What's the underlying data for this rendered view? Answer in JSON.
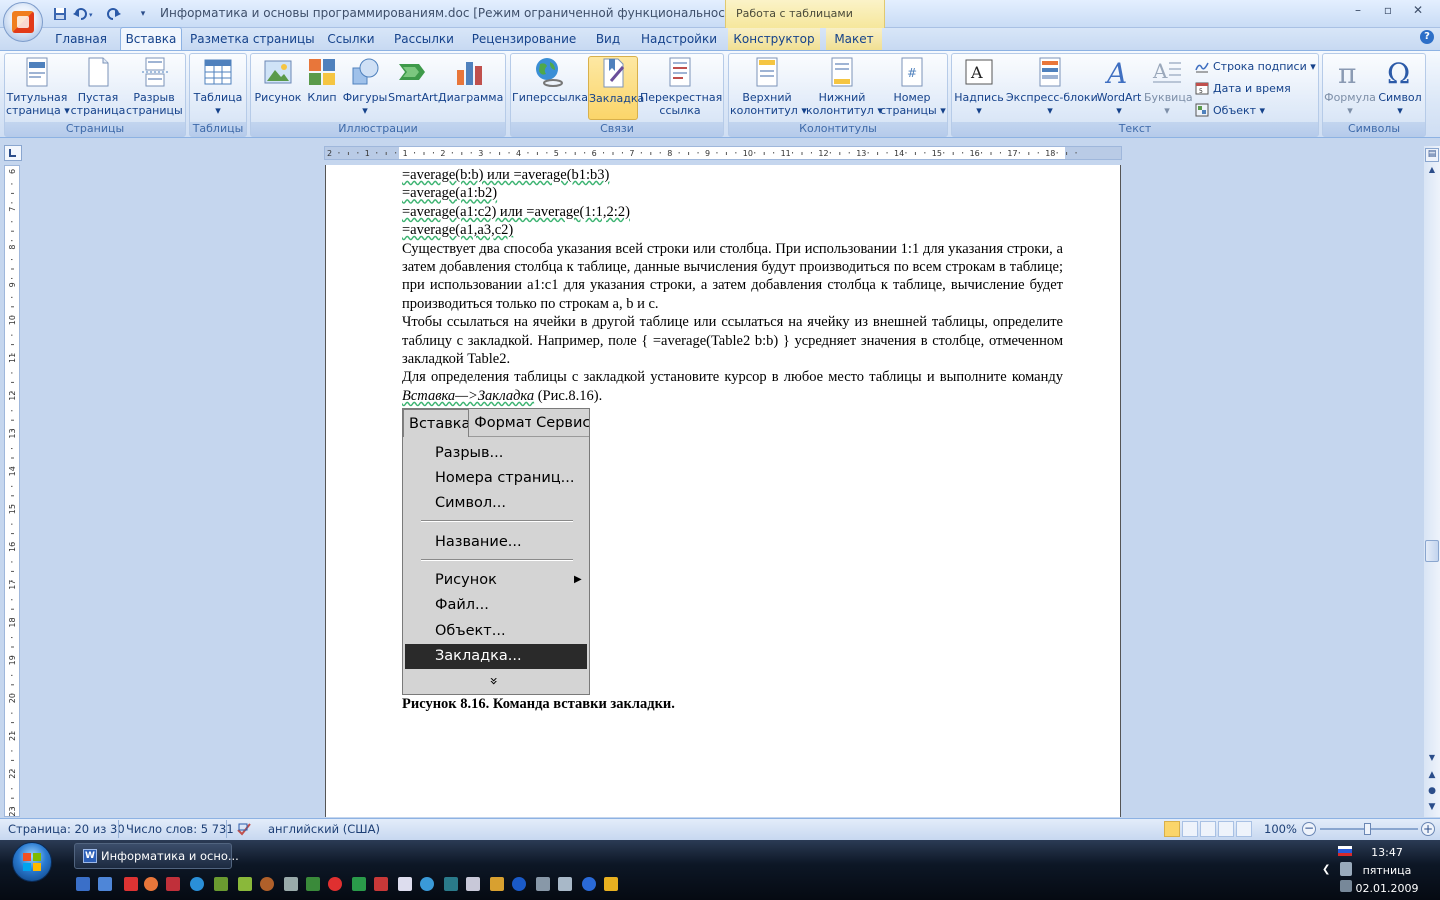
{
  "window": {
    "title": "Информатика и основы программированиям.doc [Режим ограниченной функциональности] - M...",
    "context_tools_label": "Работа с таблицами"
  },
  "tabs": [
    "Главная",
    "Вставка",
    "Разметка страницы",
    "Ссылки",
    "Рассылки",
    "Рецензирование",
    "Вид",
    "Надстройки",
    "Конструктор",
    "Макет"
  ],
  "ribbon": {
    "groups": {
      "pages": "Страницы",
      "tables": "Таблицы",
      "illustrations": "Иллюстрации",
      "links": "Связи",
      "header_footer": "Колонтитулы",
      "text": "Текст",
      "symbols": "Символы"
    },
    "buttons": {
      "cover_page_1": "Титульная",
      "cover_page_2": "страница ▾",
      "blank_page_1": "Пустая",
      "blank_page_2": "страница",
      "page_break_1": "Разрыв",
      "page_break_2": "страницы",
      "table_1": "Таблица",
      "table_2": "▾",
      "picture": "Рисунок",
      "clip": "Клип",
      "shapes_1": "Фигуры",
      "shapes_2": "▾",
      "smartart": "SmartArt",
      "chart": "Диаграмма",
      "hyperlink": "Гиперссылка",
      "bookmark": "Закладка",
      "crossref_1": "Перекрестная",
      "crossref_2": "ссылка",
      "header_1": "Верхний",
      "header_2": "колонтитул ▾",
      "footer_1": "Нижний",
      "footer_2": "колонтитул ▾",
      "page_number_1": "Номер",
      "page_number_2": "страницы ▾",
      "textbox_1": "Надпись",
      "textbox_2": "▾",
      "quickparts_1": "Экспресс-блоки",
      "quickparts_2": "▾",
      "wordart_1": "WordArt",
      "wordart_2": "▾",
      "dropcap_1": "Буквица",
      "dropcap_2": "▾",
      "signature_line": "Строка подписи ▾",
      "date_time": "Дата и время",
      "object": "Объект ▾",
      "equation_1": "Формула",
      "equation_2": "▾",
      "symbol_1": "Символ",
      "symbol_2": "▾"
    }
  },
  "ruler_numbers": [
    "2",
    "1",
    "1",
    "2",
    "3",
    "4",
    "5",
    "6",
    "7",
    "8",
    "9",
    "10",
    "11",
    "12",
    "13",
    "14",
    "15",
    "16",
    "17",
    "18"
  ],
  "vruler_numbers": [
    "6",
    "7",
    "8",
    "9",
    "10",
    "11",
    "12",
    "13",
    "14",
    "15",
    "16",
    "17",
    "18",
    "19",
    "20",
    "21",
    "22",
    "23"
  ],
  "document": {
    "line1": "=average(b:b) или =average(b1:b3)",
    "line2": "=average(a1:b2)",
    "line3": "=average(a1:c2) или =average(1:1,2:2)",
    "line4": "=average(a1,a3,c2)",
    "para1": "Существует два способа указания всей строки или столбца. При использовании 1:1 для указания строки, а затем добавления столбца к таблице, данные вычисления будут производиться по всем строкам в таблице; при использовании a1:c1 для указания строки, а затем добавления столбца к таблице, вычисление будет производиться только по строкам a, b и c.",
    "para2": "Чтобы ссылаться на ячейки в другой таблице или ссылаться на ячейку из внешней таблицы, определите таблицу с закладкой. Например, поле { =average(Table2 b:b) } усредняет значения в столбце, отмеченном закладкой Table2.",
    "para3_a": "Для определения таблицы с закладкой установите курсор в любое место таблицы и выполните команду ",
    "para3_em": "Вставка—>Закладка",
    "para3_b": " (Рис.8.16).",
    "caption": "Рисунок 8.16. Команда вставки закладки."
  },
  "figure_menu": {
    "bar": [
      "Вставка",
      "Формат",
      "Сервис"
    ],
    "items": [
      "Разрыв...",
      "Номера страниц...",
      "Символ...",
      "Название...",
      "Рисунок",
      "Файл...",
      "Объект...",
      "Закладка..."
    ],
    "more": "»"
  },
  "status": {
    "page": "Страница: 20 из 30",
    "words": "Число слов: 5 731",
    "language": "английский (США)",
    "zoom": "100%"
  },
  "taskbar": {
    "word_task": "Информатика и осно...",
    "time": "13:47",
    "day": "пятница",
    "date": "02.01.2009"
  }
}
